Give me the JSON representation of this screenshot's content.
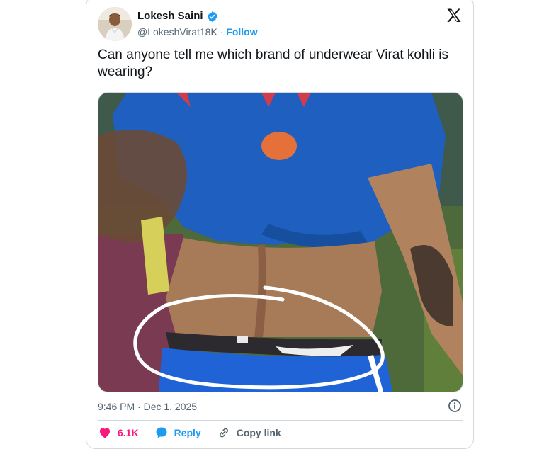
{
  "author": {
    "name": "Lokesh Saini",
    "handle": "@LokeshVirat18K",
    "separator": "·",
    "follow_label": "Follow"
  },
  "post": {
    "text": "Can anyone tell me which brand of underwear Virat kohli is wearing?",
    "timestamp": "9:46 PM · Dec 1, 2025"
  },
  "actions": {
    "like_count": "6.1K",
    "reply_label": "Reply",
    "copy_link_label": "Copy link"
  },
  "icons": {
    "brand": "x-logo-icon",
    "verified": "verified-badge-icon",
    "info": "info-icon",
    "like": "heart-icon",
    "reply": "reply-bubble-icon",
    "copy": "link-icon"
  },
  "colors": {
    "accent": "#1d9bf0",
    "like": "#f91880",
    "secondary_text": "#536471",
    "border": "#cfd9de"
  }
}
